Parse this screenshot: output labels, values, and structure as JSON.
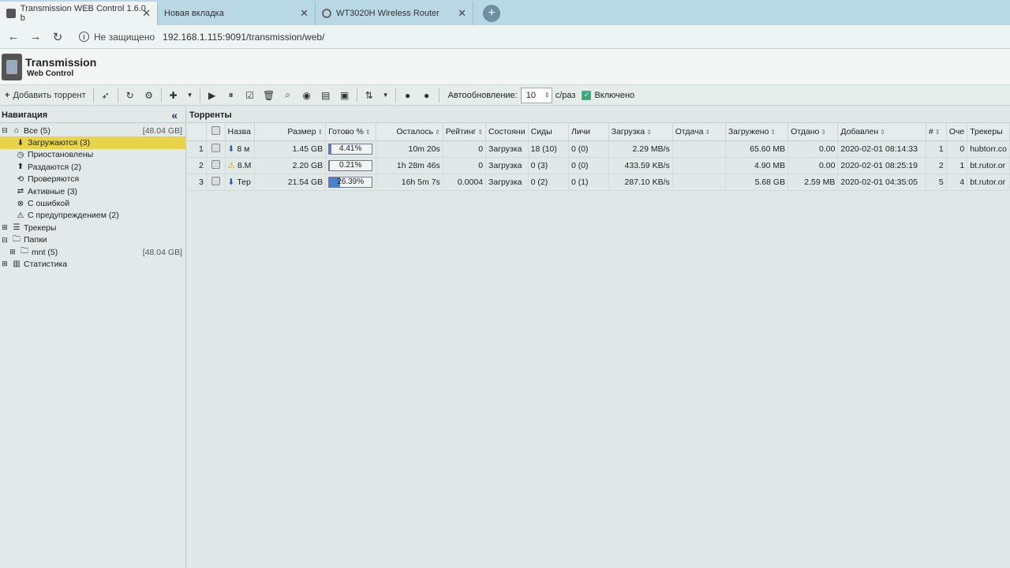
{
  "browser": {
    "tabs": [
      {
        "title": "Transmission WEB Control 1.6.0 b"
      },
      {
        "title": "Новая вкладка"
      },
      {
        "title": "WT3020H Wireless Router"
      }
    ],
    "security_label": "Не защищено",
    "url": "192.168.1.115:9091/transmission/web/"
  },
  "app": {
    "title": "Transmission",
    "subtitle": "Web Control"
  },
  "toolbar": {
    "add_torrent": "Добавить торрент",
    "auto_update_label": "Автообновление:",
    "auto_update_value": "10",
    "per_label": "с/раз",
    "enabled_label": "Включено"
  },
  "nav": {
    "header": "Навигация",
    "items": [
      {
        "label": "Все (5)",
        "size": "[48.04 GB]",
        "icon": "home-icon"
      },
      {
        "label": "Загружаются (3)",
        "icon": "download-icon"
      },
      {
        "label": "Приостановлены",
        "icon": "clock-icon"
      },
      {
        "label": "Раздаются (2)",
        "icon": "upload-icon"
      },
      {
        "label": "Проверяются",
        "icon": "check-icon"
      },
      {
        "label": "Активные (3)",
        "icon": "swap-icon"
      },
      {
        "label": "С ошибкой",
        "icon": "error-icon"
      },
      {
        "label": "С предупреждением (2)",
        "icon": "warning-icon"
      },
      {
        "label": "Трекеры",
        "icon": "tracker-icon"
      },
      {
        "label": "Папки",
        "icon": "folder-icon"
      },
      {
        "label": "mnt (5)",
        "size": "[48.04 GB]",
        "icon": "folder-icon"
      },
      {
        "label": "Статистика",
        "icon": "stats-icon"
      }
    ]
  },
  "main": {
    "header": "Торренты",
    "columns": [
      "Назва",
      "Размер",
      "Готово %",
      "Осталось",
      "Рейтинг",
      "Состояни",
      "Сиды",
      "Личи",
      "Загрузка",
      "Отдача",
      "Загружено",
      "Отдано",
      "Добавлен",
      "#",
      "Оче",
      "Трекеры"
    ],
    "rows": [
      {
        "index": "1",
        "name": "8 м",
        "size": "1.45 GB",
        "progress": 4.41,
        "progress_text": "4.41%",
        "remaining": "10m 20s",
        "ratio": "0",
        "state": "Загрузка",
        "seeds": "18 (10)",
        "peers": "0 (0)",
        "download": "2.29 MB/s",
        "upload": "",
        "downloaded": "65.60 MB",
        "uploaded": "0.00",
        "added": "2020-02-01 08:14:33",
        "id": "1",
        "queue": "0",
        "tracker": "hubtorr.co"
      },
      {
        "index": "2",
        "name": "8.М",
        "size": "2.20 GB",
        "progress": 0.21,
        "progress_text": "0.21%",
        "remaining": "1h 28m 46s",
        "ratio": "0",
        "state": "Загрузка",
        "seeds": "0 (3)",
        "peers": "0 (0)",
        "download": "433.59 KB/s",
        "upload": "",
        "downloaded": "4.90 MB",
        "uploaded": "0.00",
        "added": "2020-02-01 08:25:19",
        "id": "2",
        "queue": "1",
        "tracker": "bt.rutor.or"
      },
      {
        "index": "3",
        "name": "Тер",
        "size": "21.54 GB",
        "progress": 26.39,
        "progress_text": "26.39%",
        "remaining": "16h 5m 7s",
        "ratio": "0.0004",
        "state": "Загрузка",
        "seeds": "0 (2)",
        "peers": "0 (1)",
        "download": "287.10 KB/s",
        "upload": "",
        "downloaded": "5.68 GB",
        "uploaded": "2.59 MB",
        "added": "2020-02-01 04:35:05",
        "id": "5",
        "queue": "4",
        "tracker": "bt.rutor.or"
      }
    ]
  }
}
